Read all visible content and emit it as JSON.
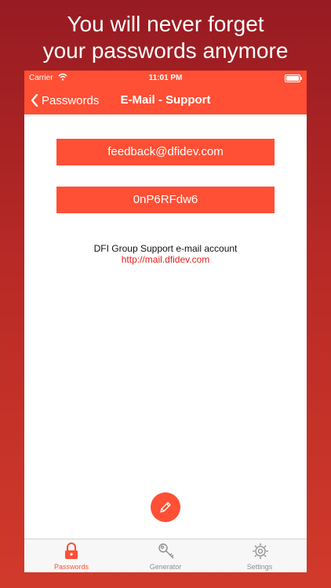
{
  "promo": {
    "line1": "You will never forget",
    "line2": "your passwords anymore"
  },
  "statusbar": {
    "carrier": "Carrier",
    "time": "11:01 PM"
  },
  "navbar": {
    "back_label": "Passwords",
    "title": "E-Mail - Support"
  },
  "entry": {
    "login": "feedback@dfidev.com",
    "password": "0nP6RFdw6",
    "description": "DFI Group Support e-mail account",
    "url": "http://mail.dfidev.com"
  },
  "tabs": [
    {
      "label": "Passwords",
      "icon": "lock-icon"
    },
    {
      "label": "Generator",
      "icon": "key-icon"
    },
    {
      "label": "Settings",
      "icon": "gear-icon"
    }
  ],
  "colors": {
    "accent": "#ff4f34",
    "background_top": "#971b22",
    "background_bottom": "#d13a2b",
    "link": "#e0201b"
  }
}
